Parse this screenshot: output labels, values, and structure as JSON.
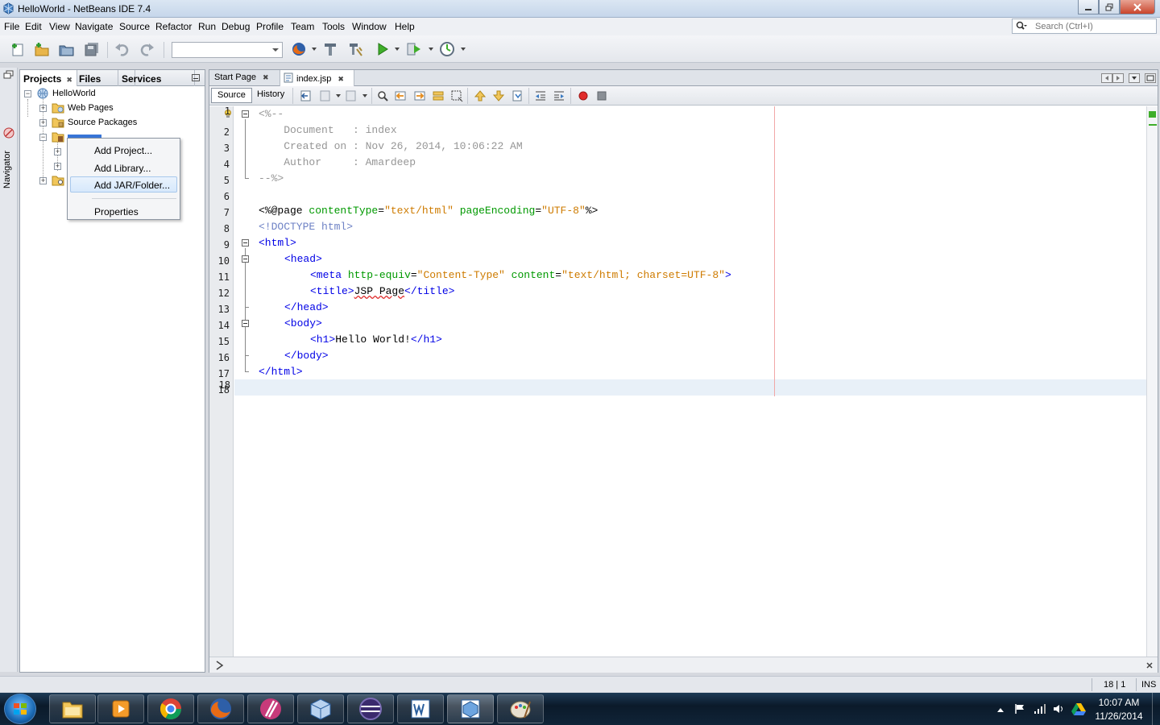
{
  "window": {
    "title": "HelloWorld - NetBeans IDE 7.4",
    "controls": [
      "minimize",
      "maximize",
      "close"
    ]
  },
  "menubar": {
    "items": [
      "File",
      "Edit",
      "View",
      "Navigate",
      "Source",
      "Refactor",
      "Run",
      "Debug",
      "Profile",
      "Team",
      "Tools",
      "Window",
      "Help"
    ],
    "search_placeholder": "Search (Ctrl+I)"
  },
  "toolbar": {
    "config_combo_value": "",
    "buttons": [
      "new-file-icon",
      "new-project-icon",
      "open-project-icon",
      "save-all-icon",
      "undo-icon",
      "redo-icon",
      "firefox-icon",
      "build-icon",
      "clean-build-icon",
      "run-icon",
      "debug-icon",
      "profile-icon"
    ]
  },
  "navigator": {
    "label": "Navigator"
  },
  "projects_panel": {
    "tabs": [
      {
        "label": "Projects",
        "active": true
      },
      {
        "label": "Files",
        "active": false
      },
      {
        "label": "Services",
        "active": false
      }
    ],
    "tree": {
      "root": "HelloWorld",
      "children": [
        "Web Pages",
        "Source Packages",
        "Libraries",
        "",
        ""
      ]
    }
  },
  "context_menu": {
    "items": [
      "Add Project...",
      "Add Library...",
      "Add JAR/Folder...",
      "Properties"
    ],
    "hovered": "Add JAR/Folder..."
  },
  "editor": {
    "tabs": [
      {
        "label": "Start Page",
        "active": false
      },
      {
        "label": "index.jsp",
        "active": true
      }
    ],
    "view_buttons": [
      "Source",
      "History"
    ],
    "active_view": "Source",
    "line_numbers": [
      "1",
      "2",
      "3",
      "4",
      "5",
      "6",
      "7",
      "8",
      "9",
      "10",
      "11",
      "12",
      "13",
      "14",
      "15",
      "16",
      "17",
      "18"
    ],
    "code": {
      "l1": "<%--",
      "l2": "    Document   : index",
      "l3": "    Created on : Nov 26, 2014, 10:06:22 AM",
      "l4": "    Author     : Amardeep",
      "l5": "--%>",
      "l7": {
        "open": "<%@page ",
        "a1": "contentType",
        "eq1": "=",
        "v1": "\"text/html\"",
        "sp": " ",
        "a2": "pageEncoding",
        "eq2": "=",
        "v2": "\"UTF-8\"",
        "close": "%>"
      },
      "l8": "<!DOCTYPE html>",
      "l9": "<html>",
      "l10": "<head>",
      "l11": {
        "open": "<meta ",
        "a1": "http-equiv",
        "eq1": "=",
        "v1": "\"Content-Type\"",
        "sp": " ",
        "a2": "content",
        "eq2": "=",
        "v2": "\"text/html; charset=UTF-8\"",
        "close": ">"
      },
      "l12": {
        "open": "<title>",
        "text": "JSP Page",
        "close": "</title>"
      },
      "l13": "</head>",
      "l14": "<body>",
      "l15": {
        "open": "<h1>",
        "text": "Hello World!",
        "close": "</h1>"
      },
      "l16": "</body>",
      "l17": "</html>",
      "l18": ""
    }
  },
  "statusbar": {
    "caret_position": "18 | 1",
    "insert_mode": "INS"
  },
  "taskbar": {
    "apps": [
      "explorer-icon",
      "media-player-icon",
      "chrome-icon",
      "firefox-icon",
      "opera-icon",
      "virtualbox-icon",
      "eclipse-icon",
      "word-icon",
      "netbeans-icon",
      "paint-icon"
    ],
    "clock_time": "10:07 AM",
    "clock_date": "11/26/2014"
  },
  "colors": {
    "tag": "#0000e6",
    "attribute": "#009900",
    "string": "#ce7b00",
    "comment": "#969696",
    "doctype": "#6e82c5"
  }
}
